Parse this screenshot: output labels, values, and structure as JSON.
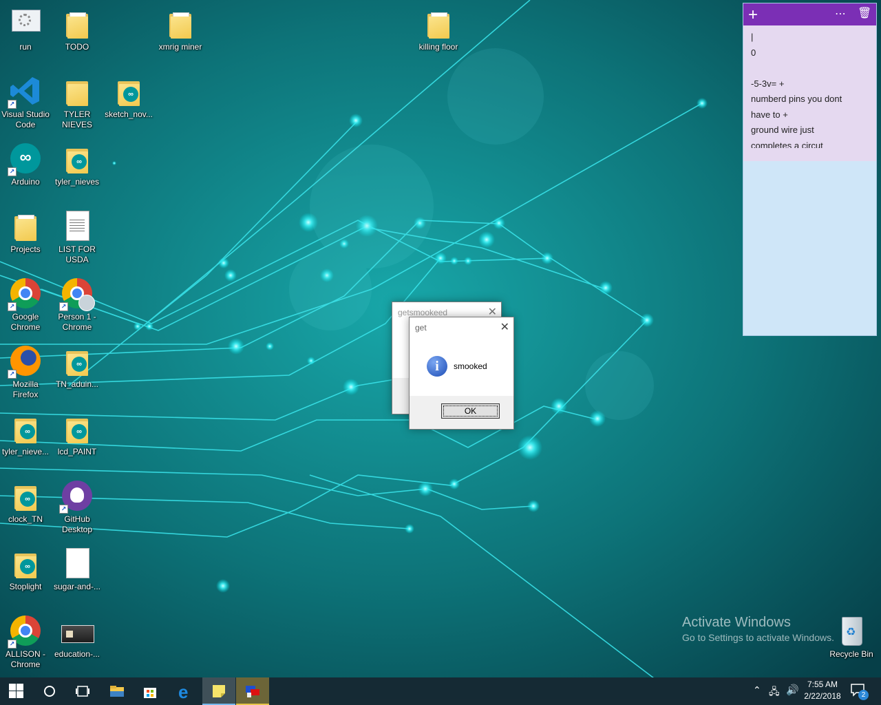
{
  "desktop_icons": [
    {
      "label": "run"
    },
    {
      "label": "TODO"
    },
    {
      "label": "xmrig miner"
    },
    {
      "label": "killing floor"
    },
    {
      "label": "Visual Studio Code"
    },
    {
      "label": "TYLER NIEVES"
    },
    {
      "label": "sketch_nov..."
    },
    {
      "label": "Arduino"
    },
    {
      "label": "tyler_nieves"
    },
    {
      "label": "Projects"
    },
    {
      "label": "LIST FOR USDA"
    },
    {
      "label": "Google Chrome"
    },
    {
      "label": "Person 1 - Chrome"
    },
    {
      "label": "Mozilla Firefox"
    },
    {
      "label": "TN_aduin..."
    },
    {
      "label": "tyler_nieve..."
    },
    {
      "label": "lcd_PAINT"
    },
    {
      "label": "clock_TN"
    },
    {
      "label": "GitHub Desktop"
    },
    {
      "label": "Stoplight"
    },
    {
      "label": "sugar-and-..."
    },
    {
      "label": "ALLISON - Chrome"
    },
    {
      "label": "education-..."
    },
    {
      "label": "Recycle Bin"
    }
  ],
  "sticky_note": {
    "lines": [
      "|",
      "0",
      "",
      "-5-3v= +",
      "numberd pins you dont",
      "have to +",
      "ground wire just",
      "completes a circut"
    ]
  },
  "dialogs": {
    "back_title": "getsmookeed",
    "front_title": "get",
    "message": "smooked",
    "ok_label": "OK"
  },
  "watermark": {
    "title": "Activate Windows",
    "subtitle": "Go to Settings to activate Windows."
  },
  "clock": {
    "time": "7:55 AM",
    "date": "2/22/2018"
  },
  "notification_count": "2",
  "colors": {
    "sticky_header": "#7b2fb5",
    "sticky_body": "#e5d9f0",
    "taskbar": "#162832"
  }
}
